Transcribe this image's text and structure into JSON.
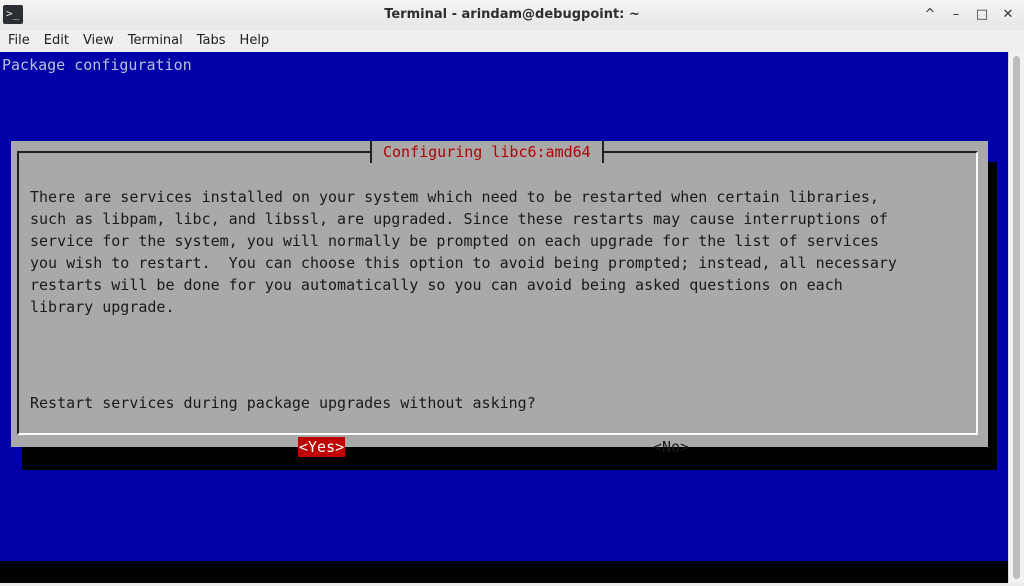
{
  "window": {
    "title": "Terminal - arindam@debugpoint: ~",
    "app_icon_glyph": ">_",
    "buttons": [
      "^",
      "–",
      "□",
      "✕"
    ]
  },
  "menubar": [
    "File",
    "Edit",
    "View",
    "Terminal",
    "Tabs",
    "Help"
  ],
  "terminal": {
    "backtitle": "Package configuration",
    "dialog": {
      "title": "Configuring libc6:amd64",
      "body_lines": [
        "There are services installed on your system which need to be restarted when certain libraries,",
        "such as libpam, libc, and libssl, are upgraded. Since these restarts may cause interruptions of",
        "service for the system, you will normally be prompted on each upgrade for the list of services",
        "you wish to restart.  You can choose this option to avoid being prompted; instead, all necessary",
        "restarts will be done for you automatically so you can avoid being asked questions on each",
        "library upgrade."
      ],
      "question": "Restart services during package upgrades without asking?",
      "yes_label": "<Yes>",
      "no_label": "<No>"
    }
  },
  "colors": {
    "terminal_bg": "#0000a8",
    "dialog_bg": "#a9a9a9",
    "title_fg": "#b30000",
    "selected_button_bg": "#c00000"
  }
}
